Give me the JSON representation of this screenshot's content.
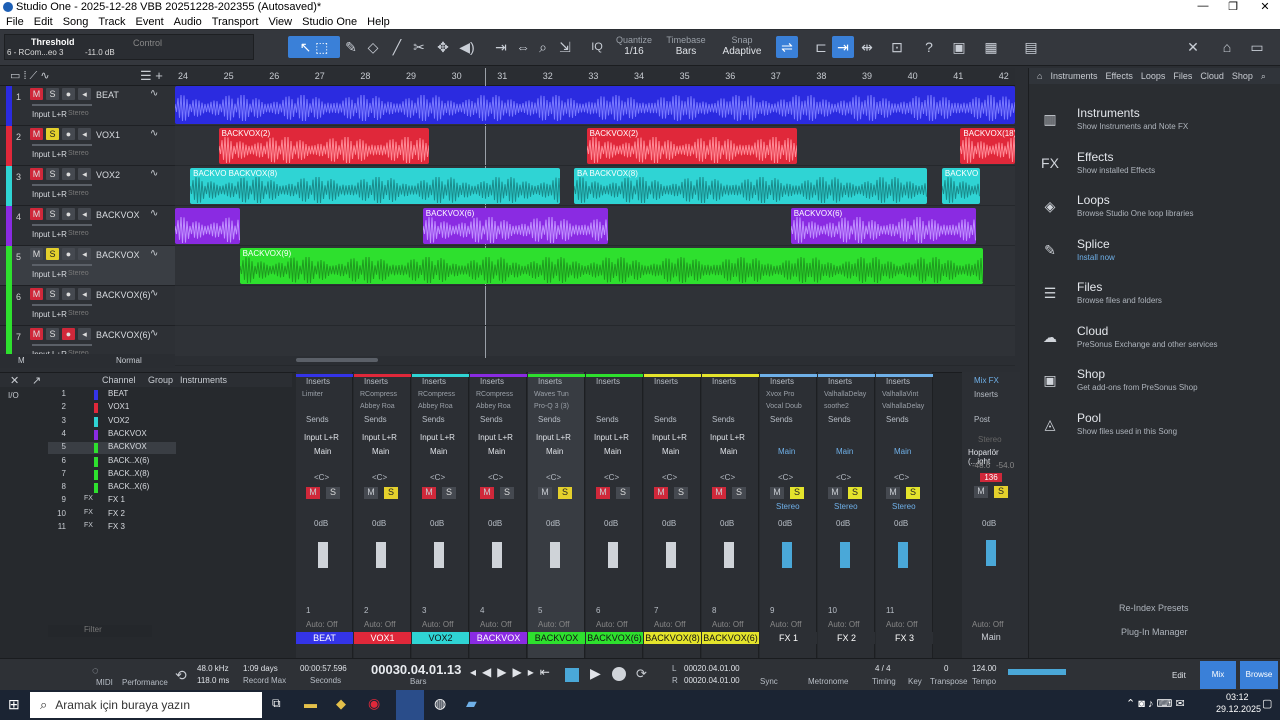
{
  "window": {
    "title": "Studio One - 2025-12-28 VBB 20251228-202355 (Autosaved)*",
    "controls": [
      "—",
      "❐",
      "✕"
    ]
  },
  "menu": [
    "File",
    "Edit",
    "Song",
    "Track",
    "Event",
    "Audio",
    "Transport",
    "View",
    "Studio One",
    "Help"
  ],
  "toolbar": {
    "plugin": "Threshold",
    "plugin_sub": "6 - RCom...eo 3",
    "plugin_val": "-11.0 dB",
    "control": "Control",
    "quantize_label": "Quantize",
    "quantize_val": "1/16",
    "timebase_label": "Timebase",
    "timebase_val": "Bars",
    "snap_label": "Snap",
    "snap_val": "Adaptive",
    "iq": "IQ"
  },
  "ruler": [
    "24",
    "25",
    "26",
    "27",
    "28",
    "29",
    "30",
    "31",
    "32",
    "33",
    "34",
    "35",
    "36",
    "37",
    "38",
    "39",
    "40",
    "41",
    "42"
  ],
  "tracks": [
    {
      "num": "1",
      "name": "BEAT",
      "input": "Input L+R",
      "stereo": "Stereo",
      "color": "#2b2be0"
    },
    {
      "num": "2",
      "name": "VOX1",
      "input": "Input L+R",
      "stereo": "Stereo",
      "color": "#e0283a"
    },
    {
      "num": "3",
      "name": "VOX2",
      "input": "Input L+R",
      "stereo": "Stereo",
      "color": "#2fd4d4"
    },
    {
      "num": "4",
      "name": "BACKVOX",
      "input": "Input L+R",
      "stereo": "Stereo",
      "color": "#8a2be2"
    },
    {
      "num": "5",
      "name": "BACKVOX",
      "input": "Input L+R",
      "stereo": "Stereo",
      "color": "#2ee02e"
    },
    {
      "num": "6",
      "name": "BACKVOX(6)",
      "input": "Input L+R",
      "stereo": "Stereo",
      "color": "#2ee02e"
    },
    {
      "num": "7",
      "name": "BACKVOX(6)",
      "input": "Input L+R",
      "stereo": "Stereo",
      "color": "#2ee02e"
    }
  ],
  "track_footer": {
    "m": "M",
    "normal": "Normal"
  },
  "clips": {
    "vox1": [
      {
        "label": "BACKVOX(2)",
        "start": 0.052,
        "w": 0.25
      },
      {
        "label": "BACKVOX(2)",
        "start": 0.49,
        "w": 0.25
      },
      {
        "label": "BACKVOX(18)",
        "start": 0.935,
        "w": 0.065
      }
    ],
    "vox2": [
      {
        "label": "BACKVO BACKVOX(8)",
        "start": 0.018,
        "w": 0.44
      },
      {
        "label": "BA BACKVOX(8)",
        "start": 0.475,
        "w": 0.42
      },
      {
        "label": "BACKVO",
        "start": 0.913,
        "w": 0.045
      }
    ],
    "back4": [
      {
        "label": "",
        "start": 0,
        "w": 0.077
      },
      {
        "label": "BACKVOX(6)",
        "start": 0.295,
        "w": 0.22
      },
      {
        "label": "BACKVOX(6)",
        "start": 0.733,
        "w": 0.22
      }
    ],
    "back5": [
      {
        "label": "BACKVOX(9)",
        "start": 0.077,
        "w": 0.885
      }
    ]
  },
  "browser": {
    "tabs": [
      "Instruments",
      "Effects",
      "Loops",
      "Files",
      "Cloud",
      "Shop"
    ],
    "items": [
      {
        "icon": "▥",
        "title": "Instruments",
        "sub": "Show Instruments and Note FX"
      },
      {
        "icon": "FX",
        "title": "Effects",
        "sub": "Show installed Effects"
      },
      {
        "icon": "◈",
        "title": "Loops",
        "sub": "Browse Studio One loop libraries"
      },
      {
        "icon": "✎",
        "title": "Splice",
        "sub": "Install now"
      },
      {
        "icon": "☰",
        "title": "Files",
        "sub": "Browse files and folders"
      },
      {
        "icon": "☁",
        "title": "Cloud",
        "sub": "PreSonus Exchange and other services"
      },
      {
        "icon": "▣",
        "title": "Shop",
        "sub": "Get add-ons from PreSonus Shop"
      },
      {
        "icon": "◬",
        "title": "Pool",
        "sub": "Show files used in this Song"
      }
    ],
    "reindex": "Re-Index Presets",
    "plugin_manager": "Plug-In Manager"
  },
  "channel_list": {
    "header": [
      "Channel",
      "Group"
    ],
    "io": "I/O",
    "instruments": "Instruments",
    "filter": "Filter",
    "rows": [
      {
        "n": "1",
        "name": "BEAT"
      },
      {
        "n": "2",
        "name": "VOX1"
      },
      {
        "n": "3",
        "name": "VOX2"
      },
      {
        "n": "4",
        "name": "BACKVOX"
      },
      {
        "n": "5",
        "name": "BACKVOX"
      },
      {
        "n": "6",
        "name": "BACK..X(6)"
      },
      {
        "n": "7",
        "name": "BACK..X(8)"
      },
      {
        "n": "8",
        "name": "BACK..X(6)"
      },
      {
        "n": "9",
        "name": "FX 1"
      },
      {
        "n": "10",
        "name": "FX 2"
      },
      {
        "n": "11",
        "name": "FX 3"
      }
    ]
  },
  "mixer": {
    "inserts": "Inserts",
    "sends": "Sends",
    "input": "Input L+R",
    "main": "Main",
    "pan": "<C>",
    "db": "0dB",
    "auto": "Auto: Off",
    "stereo": "Stereo",
    "mixfx": "Mix FX",
    "post": "Post",
    "speaker": "Hoparlör (...ight",
    "main_label": "Main",
    "main_db": "136",
    "main_l": "-48.6",
    "main_r": "-54.0",
    "channels": [
      {
        "n": "1",
        "label": "BEAT",
        "color": "#3434e8",
        "ins": [
          "Limiter"
        ],
        "mc": "#d0283a",
        "sc": "#454950"
      },
      {
        "n": "2",
        "label": "VOX1",
        "color": "#e0283a",
        "ins": [
          "RCompress",
          "Abbey Roa"
        ],
        "mc": "#454950",
        "sc": "#e4d02c"
      },
      {
        "n": "3",
        "label": "VOX2",
        "color": "#2fd4d4",
        "ins": [
          "RCompress",
          "Abbey Roa"
        ],
        "mc": "#d0283a",
        "sc": "#454950"
      },
      {
        "n": "4",
        "label": "BACKVOX",
        "color": "#8a2be2",
        "ins": [
          "RCompress",
          "Abbey Roa"
        ],
        "mc": "#d0283a",
        "sc": "#454950"
      },
      {
        "n": "5",
        "label": "BACKVOX",
        "color": "#2ee02e",
        "ins": [
          "Waves Tun",
          "Pro-Q 3 (3)"
        ],
        "mc": "#454950",
        "sc": "#e4d02c"
      },
      {
        "n": "6",
        "label": "BACKVOX(6)",
        "color": "#2ee02e",
        "ins": [],
        "mc": "#d0283a",
        "sc": "#454950"
      },
      {
        "n": "7",
        "label": "BACKVOX(8)",
        "color": "#e4e42c",
        "ins": [],
        "mc": "#d0283a",
        "sc": "#454950"
      },
      {
        "n": "8",
        "label": "BACKVOX(6)",
        "color": "#e4e42c",
        "ins": [],
        "mc": "#d0283a",
        "sc": "#454950"
      },
      {
        "n": "9",
        "label": "FX 1",
        "color": "#2c2f34",
        "ins": [
          "Xvox Pro",
          "Vocal Doub"
        ],
        "mc": "#454950",
        "sc": "#e4e42c"
      },
      {
        "n": "10",
        "label": "FX 2",
        "color": "#2c2f34",
        "ins": [
          "ValhallaDelay",
          "soothe2"
        ],
        "mc": "#454950",
        "sc": "#e4e42c"
      },
      {
        "n": "11",
        "label": "FX 3",
        "color": "#2c2f34",
        "ins": [
          "ValhallaVint",
          "ValhallaDelay"
        ],
        "mc": "#454950",
        "sc": "#e4e42c"
      }
    ]
  },
  "transport": {
    "sr": "48.0 kHz",
    "sr2": "118.0 ms",
    "days": "1:09 days",
    "rec_max": "Record Max",
    "time": "00:00:57.596",
    "seconds": "Seconds",
    "bars": "00030.04.01.13",
    "bars_lbl": "Bars",
    "L": "00020.04.01.00",
    "R": "00020.04.01.00",
    "sync": "Sync",
    "metronome": "Metronome",
    "sig": "4 / 4",
    "timing": "Timing",
    "key": "Key",
    "transpose": "0",
    "transpose_lbl": "Transpose",
    "tempo": "124.00",
    "tempo_lbl": "Tempo",
    "midi": "MIDI",
    "performance": "Performance",
    "edit": "Edit",
    "mix": "Mix",
    "browse": "Browse"
  },
  "taskbar": {
    "search": "Aramak için buraya yazın",
    "time": "03:12",
    "date": "29.12.2025"
  }
}
